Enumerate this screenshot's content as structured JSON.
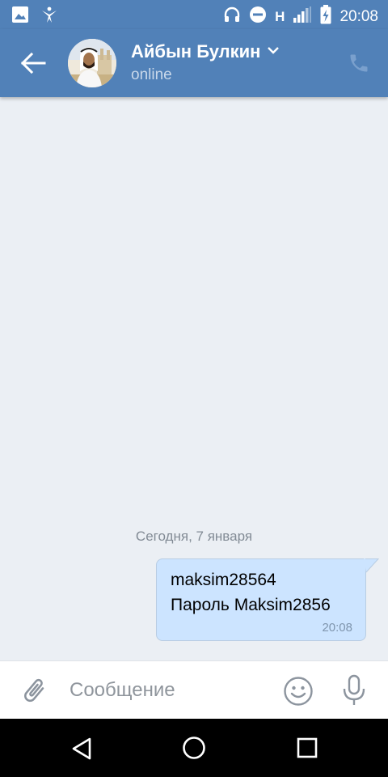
{
  "status_bar": {
    "time": "20:08",
    "network_label": "H",
    "icons": [
      "image-icon",
      "app-notification-icon",
      "headphones-icon",
      "do-not-disturb-icon",
      "signal-icon",
      "battery-charging-icon"
    ]
  },
  "header": {
    "contact_name": "Айбын Булкин",
    "status": "online",
    "icons": [
      "back-arrow-icon",
      "avatar",
      "chevron-down-icon",
      "phone-icon"
    ]
  },
  "chat": {
    "date_separator": "Сегодня, 7 января",
    "messages": [
      {
        "lines": [
          "maksim28564",
          "Пароль Maksim2856"
        ],
        "time": "20:08",
        "direction": "outgoing"
      }
    ]
  },
  "input_bar": {
    "placeholder": "Сообщение",
    "value": "",
    "icons": [
      "paperclip-icon",
      "emoji-icon",
      "microphone-icon"
    ]
  },
  "nav_bar": {
    "icons": [
      "nav-back-icon",
      "nav-home-icon",
      "nav-recents-icon"
    ]
  },
  "colors": {
    "header_blue": "#5181b8",
    "chat_background": "#ebeff4",
    "outgoing_bubble": "#cce4ff",
    "status_text": "#c9d8ea"
  }
}
